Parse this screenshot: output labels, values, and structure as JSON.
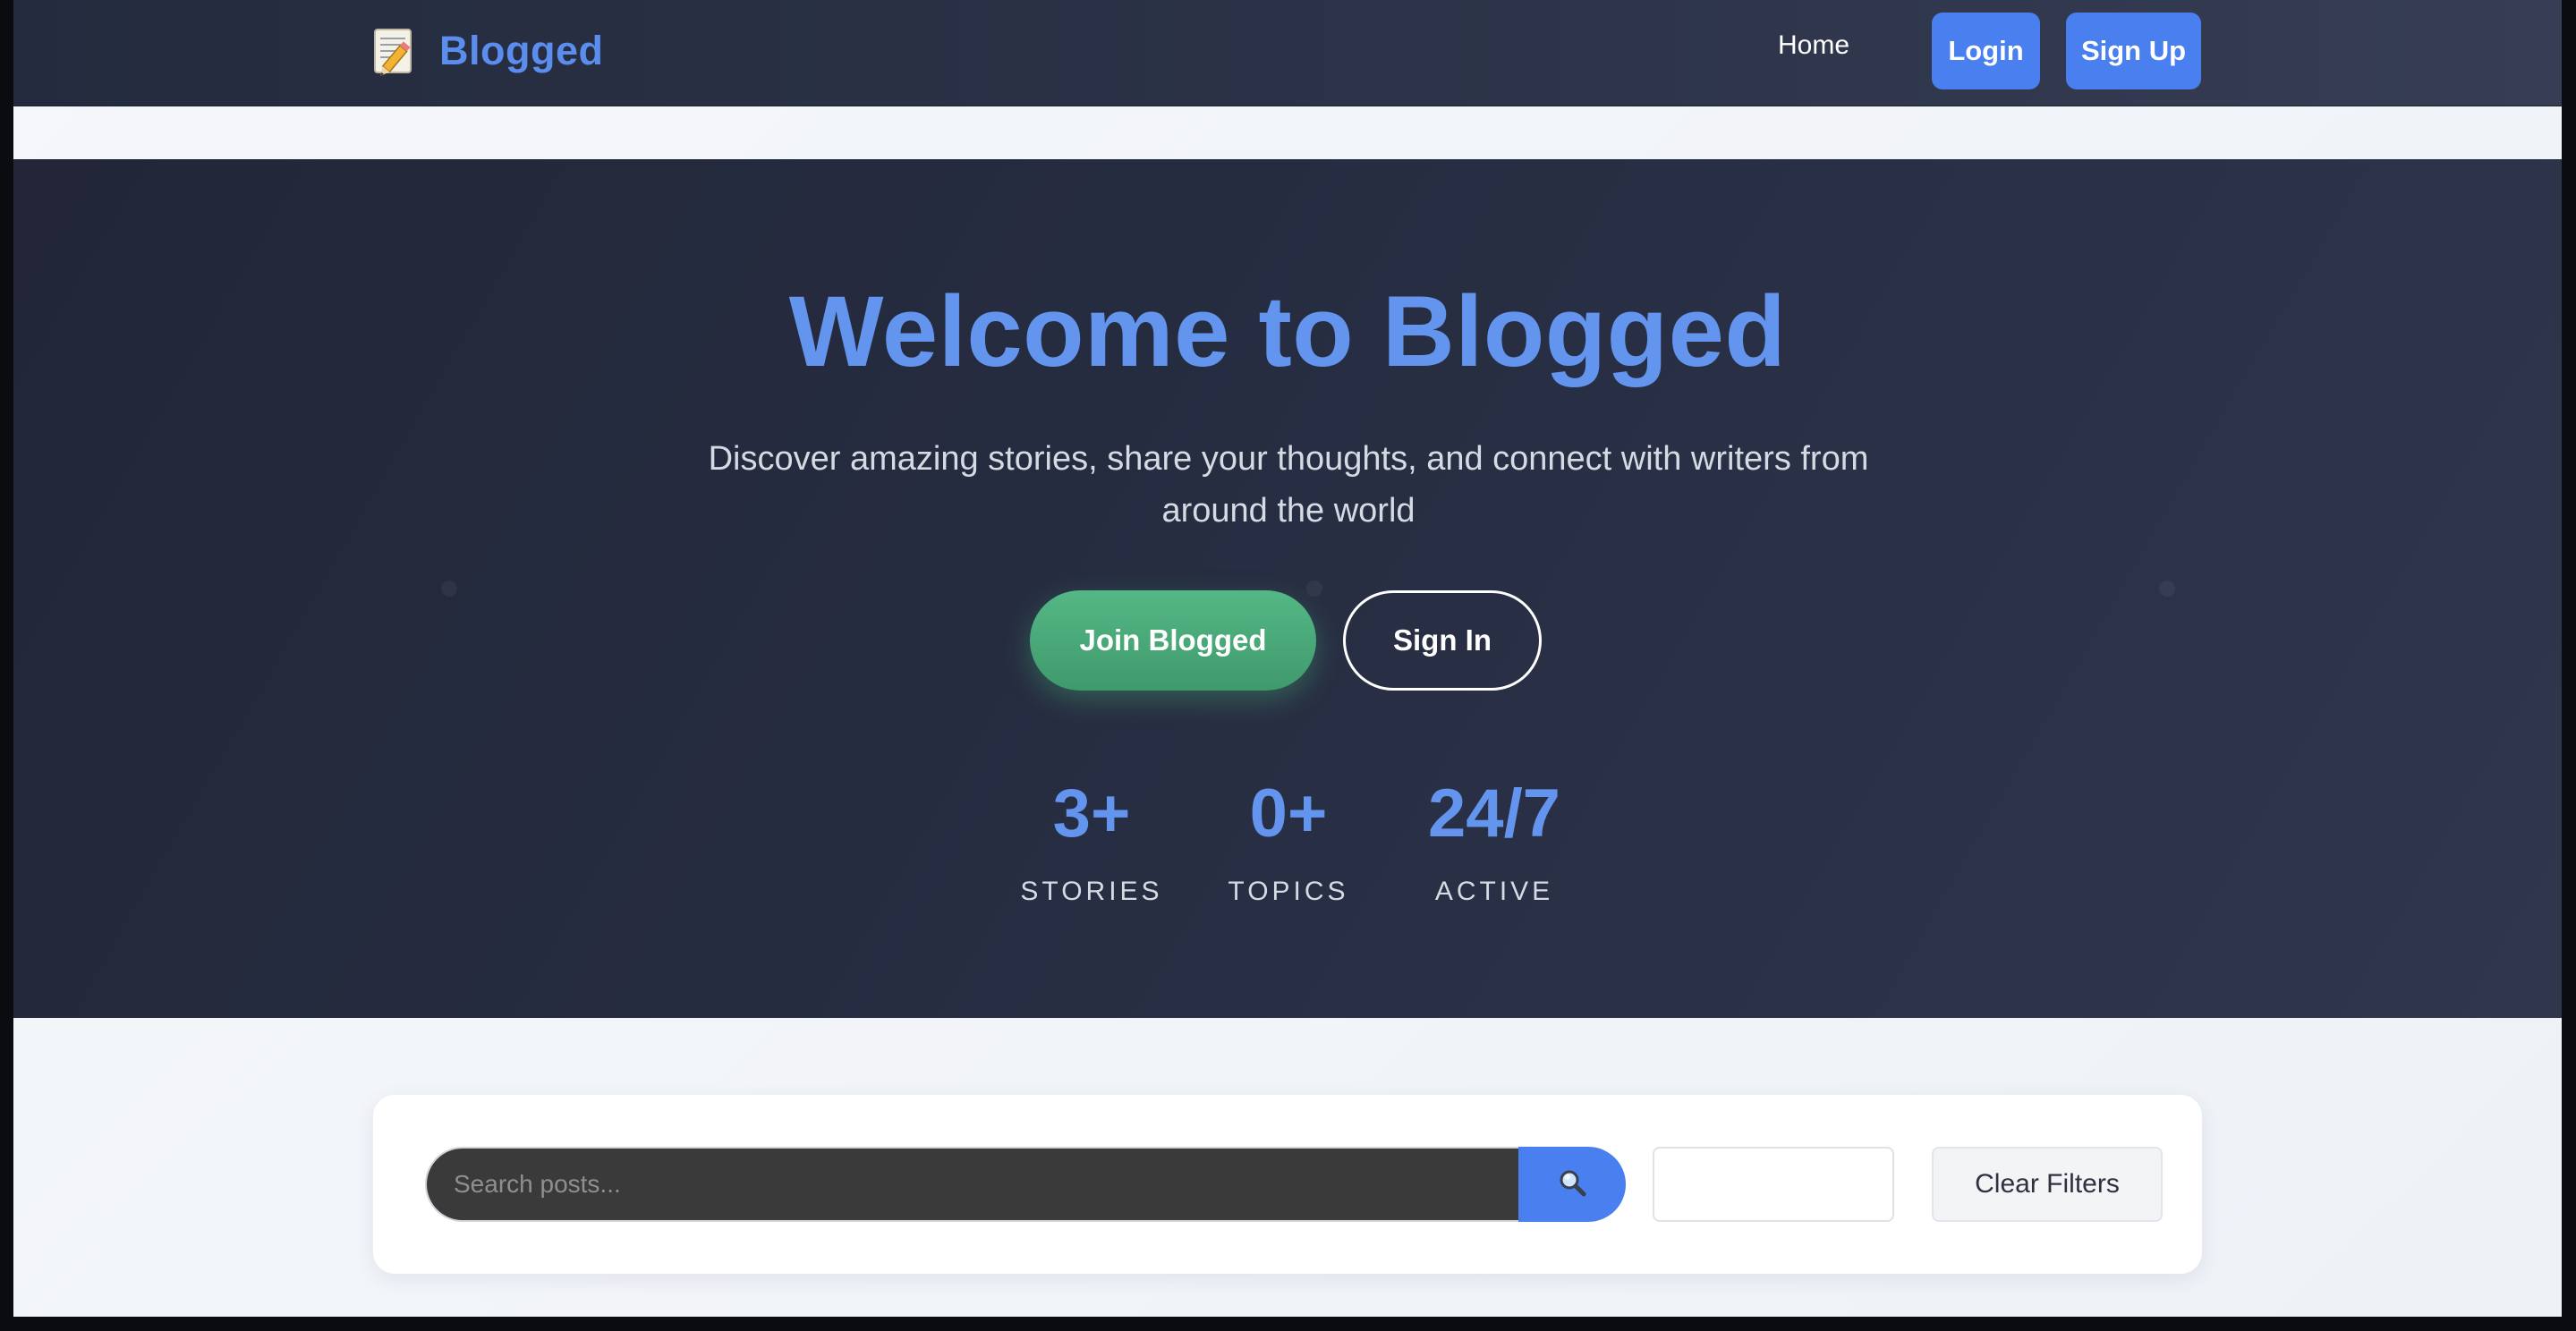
{
  "navbar": {
    "brand_icon": "memo-pencil-icon",
    "brand_name": "Blogged",
    "home_label": "Home",
    "login_label": "Login",
    "signup_label": "Sign Up"
  },
  "hero": {
    "title": "Welcome to Blogged",
    "subtitle": "Discover amazing stories, share your thoughts, and connect with writers from around the world",
    "join_label": "Join Blogged",
    "signin_label": "Sign In",
    "stats": [
      {
        "value": "3+",
        "label": "STORIES"
      },
      {
        "value": "0+",
        "label": "TOPICS"
      },
      {
        "value": "24/7",
        "label": "ACTIVE"
      }
    ]
  },
  "search": {
    "placeholder": "Search posts...",
    "search_icon": "magnifier-icon",
    "category_value": "",
    "clear_label": "Clear Filters"
  },
  "colors": {
    "accent": "#5b8def",
    "button_blue": "#4a7ff0",
    "join_green": "#48bb78",
    "navbar_bg": "#2c3348",
    "hero_bg": "#262c40"
  }
}
